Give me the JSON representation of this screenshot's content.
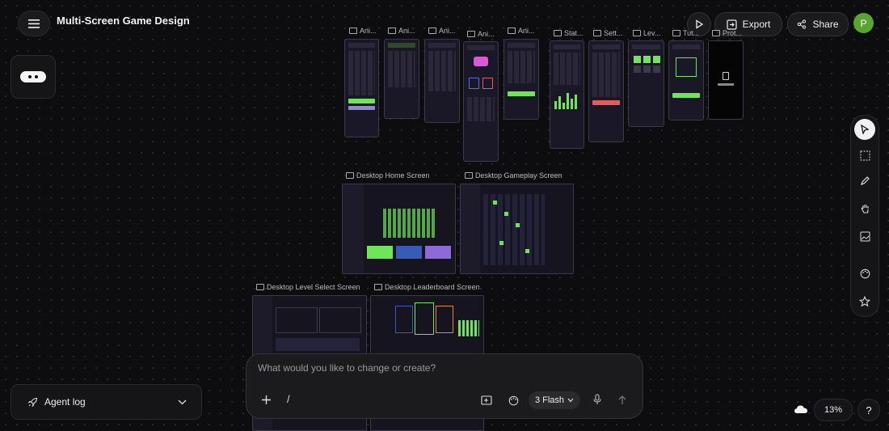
{
  "header": {
    "title": "Multi-Screen Game Design",
    "export_label": "Export",
    "share_label": "Share",
    "avatar_initial": "P"
  },
  "canvas": {
    "mobile_frames": [
      {
        "label": "Ani..."
      },
      {
        "label": "Ani..."
      },
      {
        "label": "Ani..."
      },
      {
        "label": "Ani..."
      },
      {
        "label": "Ani..."
      },
      {
        "label": "Stat..."
      },
      {
        "label": "Sett..."
      },
      {
        "label": "Lev..."
      },
      {
        "label": "Tut..."
      },
      {
        "label": "Prot..."
      }
    ],
    "desktop_frames": [
      {
        "label": "Desktop Home Screen"
      },
      {
        "label": "Desktop Gameplay Screen"
      },
      {
        "label": "Desktop Level Select Screen"
      },
      {
        "label": "Desktop Leaderboard Screen"
      }
    ]
  },
  "prompt": {
    "placeholder": "What would you like to change or create?",
    "slash": "/",
    "model_label": "3 Flash"
  },
  "agent_log": {
    "label": "Agent log"
  },
  "zoom": {
    "level": "13%"
  },
  "help": {
    "label": "?"
  },
  "colors": {
    "accent_green": "#6ee65a",
    "accent_purple": "#8e8ad8",
    "background": "#0d0d0f"
  }
}
